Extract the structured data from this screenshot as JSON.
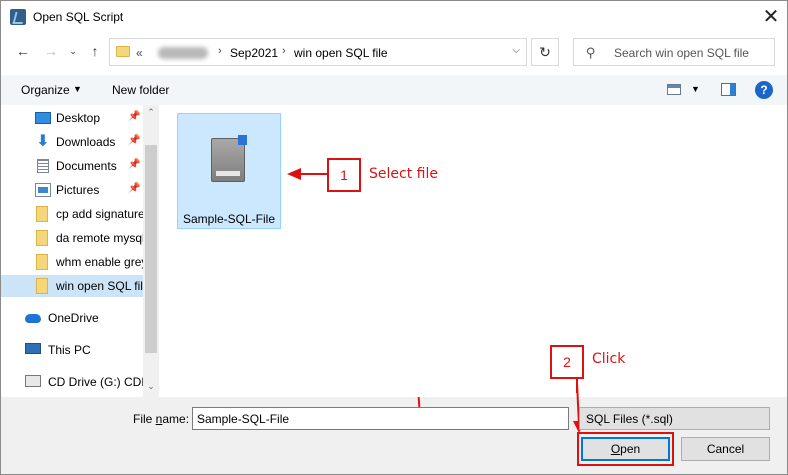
{
  "window": {
    "title": "Open SQL Script",
    "close_label": "✕"
  },
  "address": {
    "root": "«",
    "crumbs": [
      "Sep2021",
      "win open SQL file"
    ],
    "separator": "›"
  },
  "search": {
    "placeholder": "Search win open SQL file"
  },
  "toolbar": {
    "organize_label": "Organize",
    "new_folder_label": "New folder",
    "help_label": "?"
  },
  "nav": {
    "quick_access": [
      {
        "label": "Desktop",
        "icon": "desktop-icon",
        "pinned": true
      },
      {
        "label": "Downloads",
        "icon": "download-icon",
        "pinned": true
      },
      {
        "label": "Documents",
        "icon": "documents-icon",
        "pinned": true
      },
      {
        "label": "Pictures",
        "icon": "pictures-icon",
        "pinned": true
      },
      {
        "label": "cp add signature",
        "icon": "folder-icon",
        "pinned": false
      },
      {
        "label": "da remote mysql",
        "icon": "folder-icon",
        "pinned": false
      },
      {
        "label": "whm enable greylisting",
        "icon": "folder-icon",
        "pinned": false
      },
      {
        "label": "win open SQL file",
        "icon": "folder-icon",
        "pinned": false,
        "selected": true
      }
    ],
    "roots": [
      {
        "label": "OneDrive",
        "icon": "onedrive-icon"
      },
      {
        "label": "This PC",
        "icon": "computer-icon"
      },
      {
        "label": "CD Drive (G:) CDROM",
        "icon": "cd-drive-icon"
      }
    ]
  },
  "files": [
    {
      "name": "Sample-SQL-File",
      "selected": true
    }
  ],
  "annotations": {
    "step1_number": "1",
    "step1_text": "Select file",
    "step2_number": "2",
    "step2_text": "Click"
  },
  "footer": {
    "file_name_label_pre": "File ",
    "file_name_label_ul": "n",
    "file_name_label_post": "ame:",
    "file_name_value": "Sample-SQL-File",
    "file_type_value": "SQL Files (*.sql)",
    "open_label_ul": "O",
    "open_label_rest": "pen",
    "cancel_label": "Cancel"
  },
  "colors": {
    "accent": "#0078d7",
    "annotation": "#dd1111",
    "selection": "#cce8ff"
  }
}
